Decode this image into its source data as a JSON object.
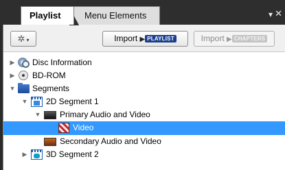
{
  "tabs": {
    "active": "Playlist",
    "inactive": "Menu Elements",
    "menu_glyph": "▾",
    "close_glyph": "✕"
  },
  "toolbar": {
    "gear_glyph": "✲",
    "gear_caret": "▾",
    "import_playlist": {
      "label": "Import",
      "arrow": "▶",
      "badge": "PLAYLIST"
    },
    "import_chapters": {
      "label": "Import",
      "arrow": "▶",
      "badge": "CHAPTERS",
      "enabled": false
    }
  },
  "tree": {
    "items": [
      {
        "label": "Disc Information",
        "icon": "disc-info-icon",
        "expander": "▶",
        "level": 0
      },
      {
        "label": "BD-ROM",
        "icon": "bd-rom-icon",
        "expander": "▶",
        "level": 0
      },
      {
        "label": "Segments",
        "icon": "folder-icon",
        "expander": "▼",
        "level": 0
      },
      {
        "label": "2D Segment 1",
        "icon": "segment-icon",
        "expander": "▼",
        "level": 1
      },
      {
        "label": "Primary Audio and Video",
        "icon": "primary-av-icon",
        "expander": "▼",
        "level": 2
      },
      {
        "label": "Video",
        "icon": "video-icon",
        "expander": "",
        "level": 3,
        "selected": true
      },
      {
        "label": "Secondary Audio and Video",
        "icon": "secondary-av-icon",
        "expander": "",
        "level": 2
      },
      {
        "label": "3D Segment 2",
        "icon": "segment-3d-icon",
        "expander": "▶",
        "level": 1
      }
    ]
  },
  "colors": {
    "selection": "#3399ff",
    "chrome": "#2e2e2e",
    "playlist_badge": "#1a3f8e"
  }
}
